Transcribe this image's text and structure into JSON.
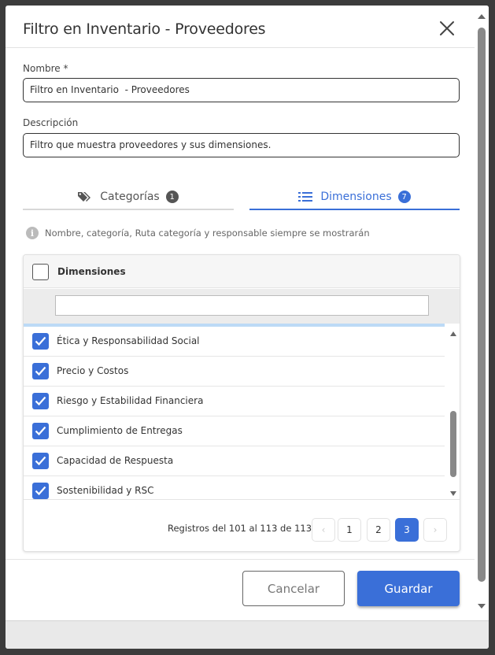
{
  "dialog": {
    "title": "Filtro en Inventario - Proveedores"
  },
  "form": {
    "name_label": "Nombre *",
    "name_value": "Filtro en Inventario  - Proveedores",
    "desc_label": "Descripción",
    "desc_value": "Filtro que muestra proveedores y sus dimensiones."
  },
  "tabs": [
    {
      "label": "Categorías",
      "count": "1",
      "icon": "tags-icon",
      "active": false
    },
    {
      "label": "Dimensiones",
      "count": "7",
      "icon": "list-icon",
      "active": true
    }
  ],
  "info": {
    "text": "Nombre, categoría, Ruta categoría y responsable siempre se mostrarán"
  },
  "grid": {
    "header": "Dimensiones",
    "filter_value": "",
    "rows": [
      {
        "label": "Ética y Responsabilidad Social",
        "checked": true
      },
      {
        "label": "Precio y Costos",
        "checked": true
      },
      {
        "label": "Riesgo y Estabilidad Financiera",
        "checked": true
      },
      {
        "label": "Cumplimiento de Entregas",
        "checked": true
      },
      {
        "label": "Capacidad de Respuesta",
        "checked": true
      },
      {
        "label": "Sostenibilidad y RSC",
        "checked": true
      }
    ]
  },
  "pager": {
    "summary": "Registros del 101 al 113 de 113",
    "prev": "‹",
    "pages": [
      "1",
      "2",
      "3"
    ],
    "current_page": "3",
    "next": "›"
  },
  "footer": {
    "cancel_label": "Cancelar",
    "save_label": "Guardar"
  },
  "colors": {
    "accent": "#3a6fd8",
    "loading_bar": "#bcdaf6"
  }
}
